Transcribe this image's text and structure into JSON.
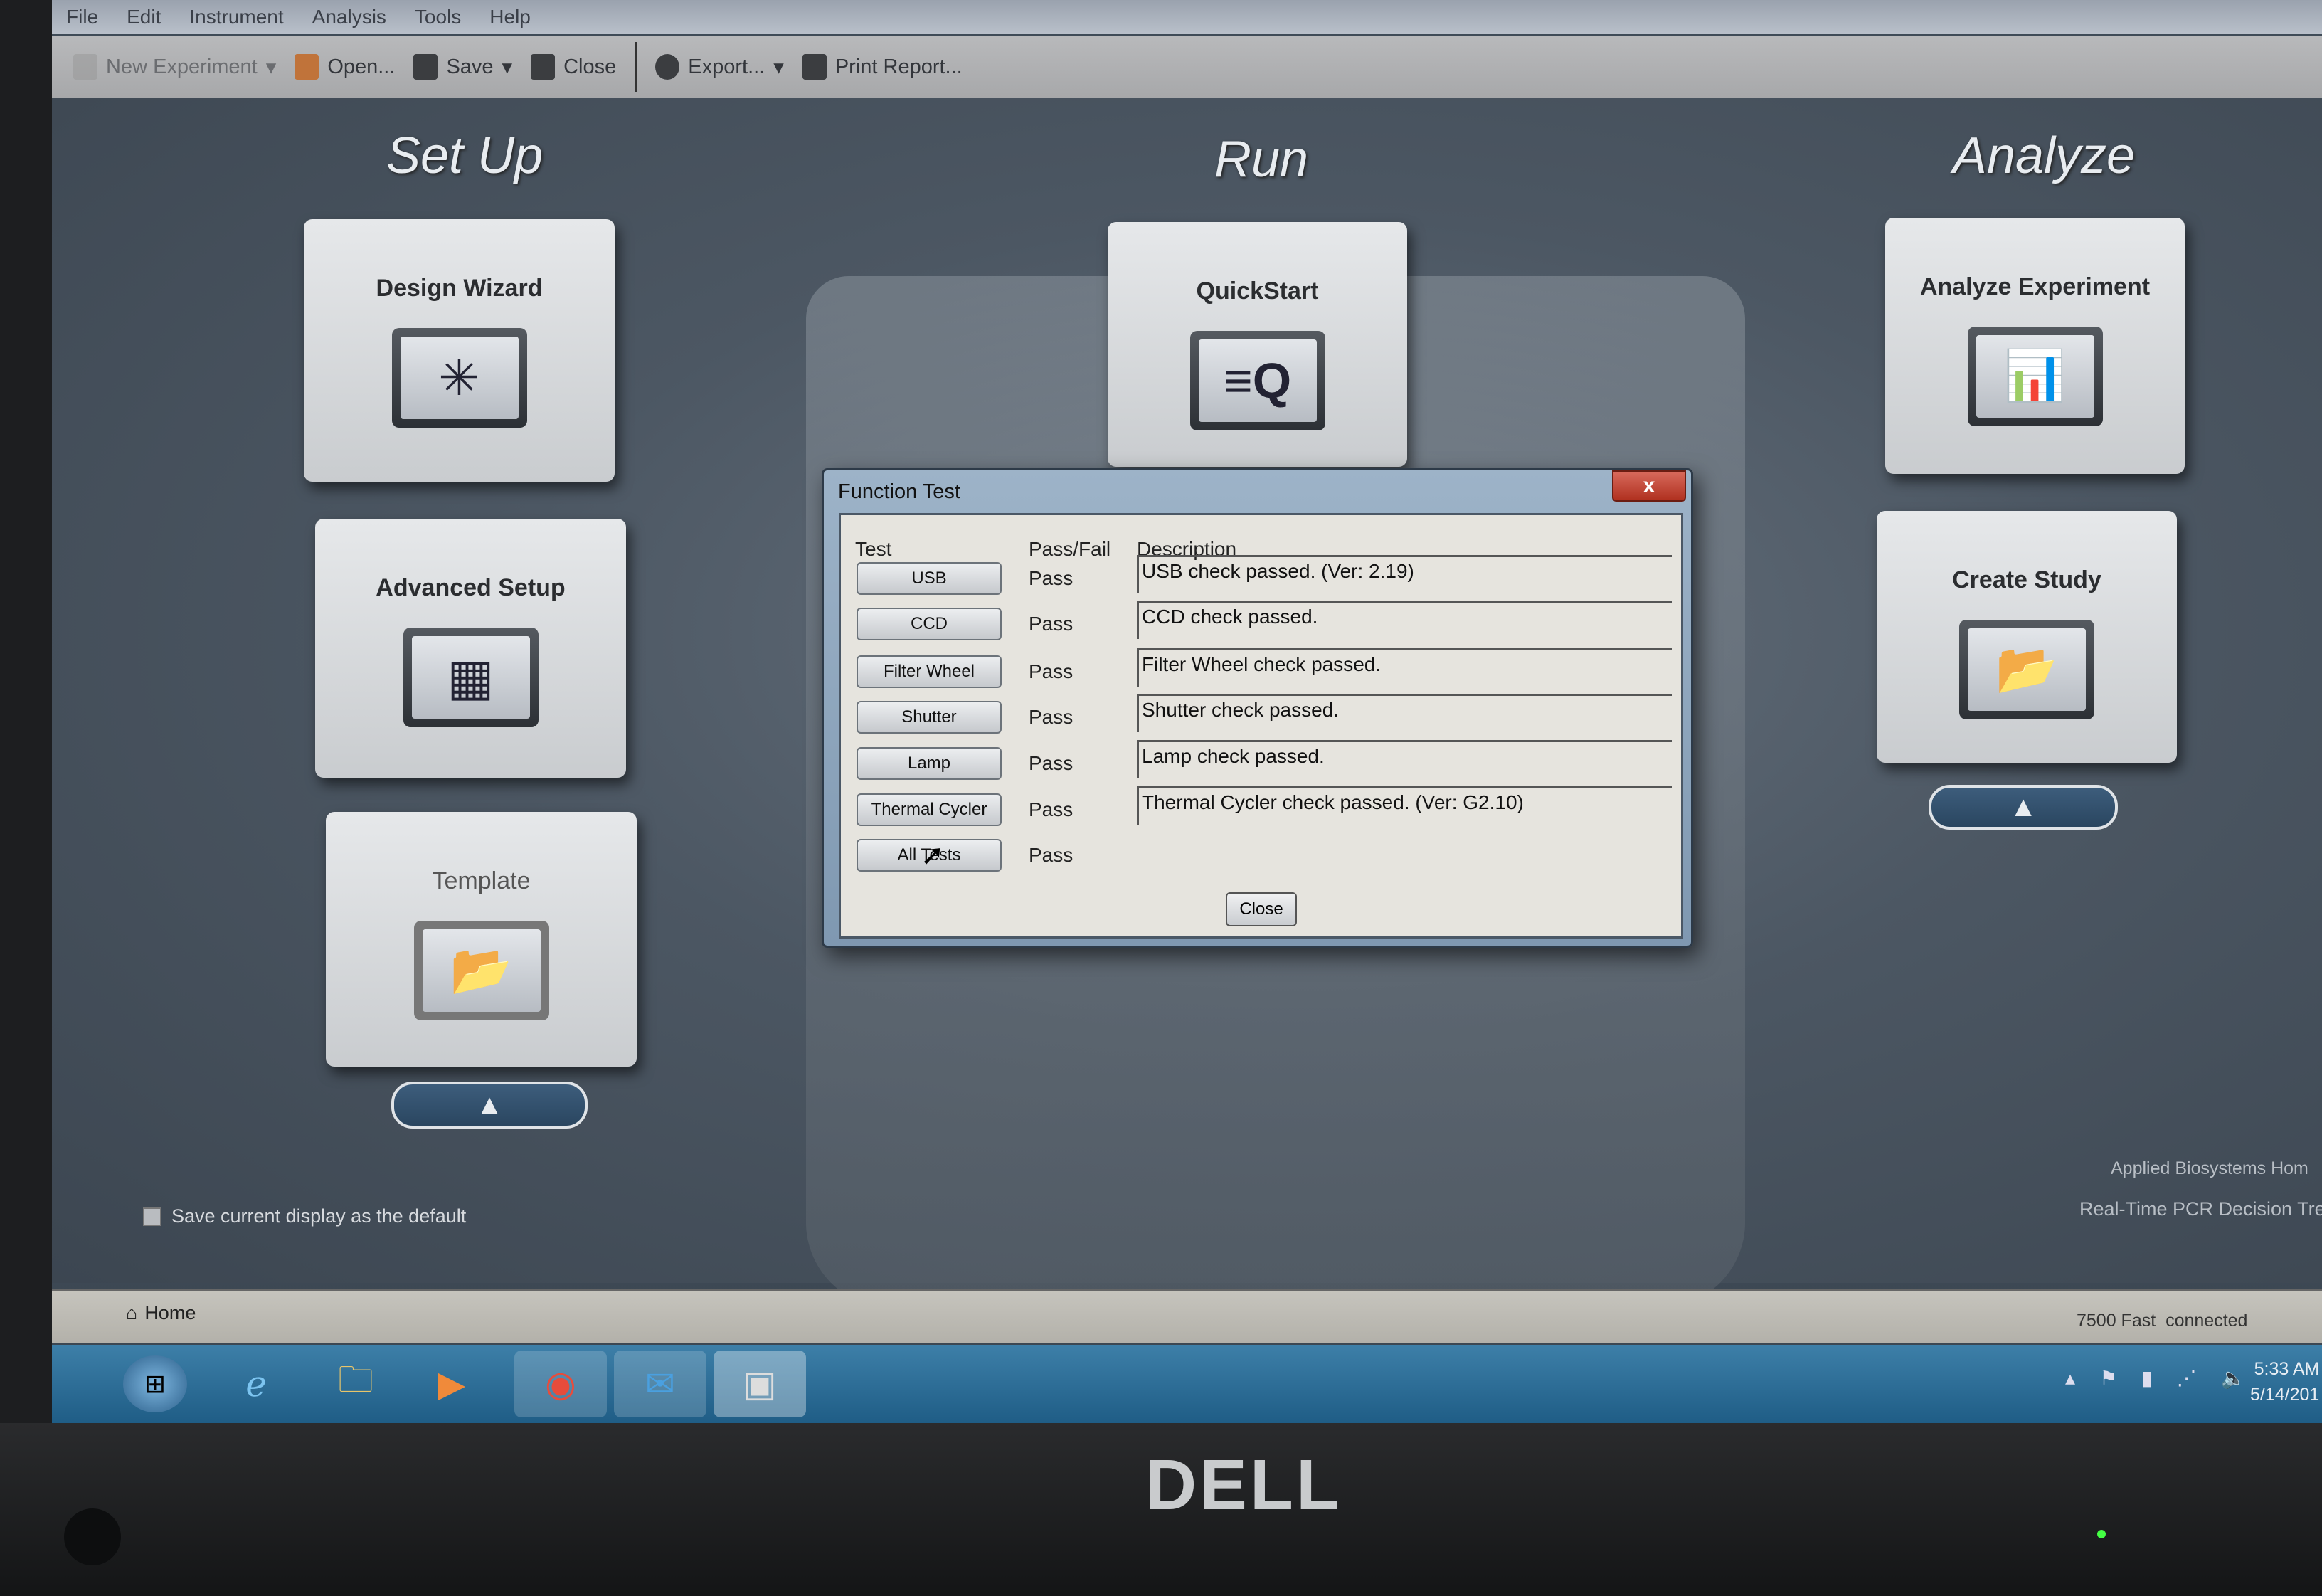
{
  "menu": [
    "File",
    "Edit",
    "Instrument",
    "Analysis",
    "Tools",
    "Help"
  ],
  "toolbar": {
    "new_experiment": "New Experiment",
    "open": "Open...",
    "save": "Save",
    "close": "Close",
    "export": "Export...",
    "print_report": "Print Report..."
  },
  "sections": {
    "setup": "Set Up",
    "run": "Run",
    "analyze": "Analyze"
  },
  "tiles": {
    "design_wizard": "Design Wizard",
    "advanced_setup": "Advanced Setup",
    "template": "Template",
    "quickstart": "QuickStart",
    "analyze_experiment": "Analyze Experiment",
    "create_study": "Create Study"
  },
  "dialog": {
    "title": "Function Test",
    "close_x": "x",
    "headers": {
      "test": "Test",
      "pass_fail": "Pass/Fail",
      "description": "Description"
    },
    "rows": [
      {
        "test": "USB",
        "result": "Pass",
        "description": "USB check passed. (Ver: 2.19)"
      },
      {
        "test": "CCD",
        "result": "Pass",
        "description": "CCD check passed."
      },
      {
        "test": "Filter Wheel",
        "result": "Pass",
        "description": "Filter Wheel check passed."
      },
      {
        "test": "Shutter",
        "result": "Pass",
        "description": "Shutter check passed."
      },
      {
        "test": "Lamp",
        "result": "Pass",
        "description": "Lamp check passed."
      },
      {
        "test": "Thermal Cycler",
        "result": "Pass",
        "description": "Thermal Cycler check passed. (Ver: G2.10)"
      },
      {
        "test": "All Tests",
        "result": "Pass",
        "description": ""
      }
    ],
    "close_label": "Close"
  },
  "save_default_label": "Save current display as the default",
  "links": [
    "Applied Biosystems Hom",
    "Real-Time PCR Decision Tre"
  ],
  "status": {
    "home": "Home",
    "instrument": "7500 Fast  connected"
  },
  "clock": {
    "time": "5:33 AM",
    "date": "5/14/201"
  },
  "brand": "DELL"
}
